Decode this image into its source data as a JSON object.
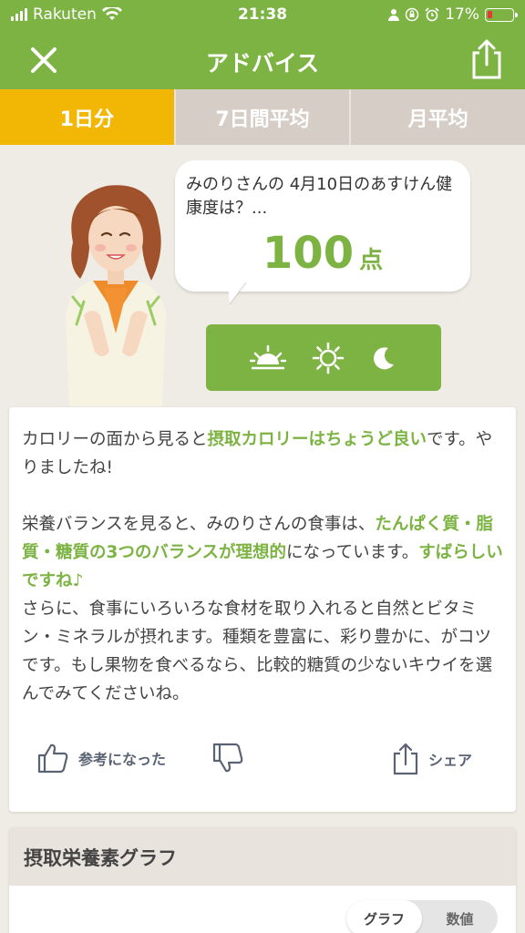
{
  "status": {
    "carrier": "Rakuten",
    "time": "21:38",
    "battery": "17%"
  },
  "header": {
    "title": "アドバイス",
    "close_icon": "close-icon",
    "share_icon": "share-icon"
  },
  "tabs": [
    {
      "label": "1日分",
      "active": true
    },
    {
      "label": "7日間平均",
      "active": false
    },
    {
      "label": "月平均",
      "active": false
    }
  ],
  "summary": {
    "question": "みのりさんの 4月10日のあすけん健康度は？...",
    "score": "100",
    "score_unit": "点"
  },
  "meals": [
    "sunrise-icon",
    "sun-icon",
    "moon-icon"
  ],
  "advice": {
    "p1_text": "カロリーの面から見ると",
    "p1_highlight": "摂取カロリーはちょうど良い",
    "p1_tail": "です。やりましたね!",
    "p2_text": "栄養バランスを見ると、みのりさんの食事は、",
    "p2_highlight": "たんぱく質・脂質・糖質の3つのバランスが理想的",
    "p2_tail": "になっています。",
    "p2_highlight2": "すばらしいですね♪",
    "p3_text": "さらに、食事にいろいろな食材を取り入れると自然とビタミン・ミネラルが摂れます。種類を豊富に、彩り豊かに、がコツです。もし果物を食べるなら、比較的糖質の少ないキウイを選んでみてくださいね。"
  },
  "actions": {
    "helpful_label": "参考になった",
    "share_label": "シェア"
  },
  "graph": {
    "title": "摂取栄養素グラフ",
    "toggle": [
      "グラフ",
      "数値"
    ]
  },
  "colors": {
    "green": "#7cb342",
    "active_tab": "#f2b705",
    "inactive_tab": "#d5cdc6"
  }
}
